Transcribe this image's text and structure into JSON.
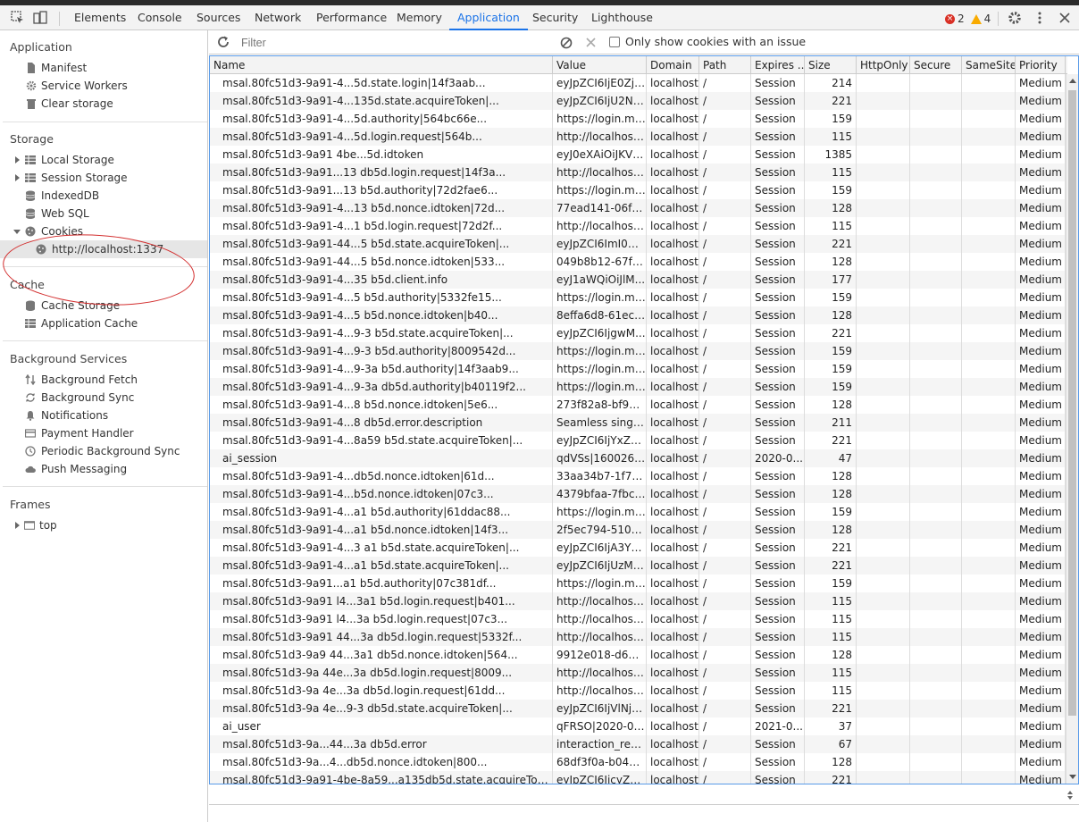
{
  "tabs": [
    "Elements",
    "Console",
    "Sources",
    "Network",
    "Performance",
    "Memory",
    "Application",
    "Security",
    "Lighthouse"
  ],
  "active_tab": "Application",
  "issues": {
    "errors": "2",
    "warnings": "4"
  },
  "sidebar": {
    "application_title": "Application",
    "application_items": [
      "Manifest",
      "Service Workers",
      "Clear storage"
    ],
    "storage_title": "Storage",
    "storage_items": [
      "Local Storage",
      "Session Storage",
      "IndexedDB",
      "Web SQL",
      "Cookies"
    ],
    "cookie_origin": "http://localhost:1337",
    "cache_title": "Cache",
    "cache_items": [
      "Cache Storage",
      "Application Cache"
    ],
    "bg_title": "Background Services",
    "bg_items": [
      "Background Fetch",
      "Background Sync",
      "Notifications",
      "Payment Handler",
      "Periodic Background Sync",
      "Push Messaging"
    ],
    "frames_title": "Frames",
    "frames_items": [
      "top"
    ]
  },
  "toolbar": {
    "filter_placeholder": "Filter",
    "only_issues_label": "Only show cookies with an issue"
  },
  "table": {
    "columns": [
      "Name",
      "Value",
      "Domain",
      "Path",
      "Expires ...",
      "Size",
      "HttpOnly",
      "Secure",
      "SameSite",
      "Priority"
    ],
    "rows": [
      [
        "msal.80fc51d3-9a91-4...5d.state.login|14f3aab...",
        "eyJpZCI6IjE0ZjN...",
        "localhost",
        "/",
        "Session",
        "214",
        "",
        "",
        "",
        "Medium"
      ],
      [
        "msal.80fc51d3-9a91-4...135d.state.acquireToken|...",
        "eyJpZCI6IjU2NG...",
        "localhost",
        "/",
        "Session",
        "221",
        "",
        "",
        "",
        "Medium"
      ],
      [
        "msal.80fc51d3-9a91-4...5d.authority|564bc66e...",
        "https://login.mic...",
        "localhost",
        "/",
        "Session",
        "159",
        "",
        "",
        "",
        "Medium"
      ],
      [
        "msal.80fc51d3-9a91-4...5d.login.request|564b...",
        "http://localhost:...",
        "localhost",
        "/",
        "Session",
        "115",
        "",
        "",
        "",
        "Medium"
      ],
      [
        "msal.80fc51d3-9a91 4be...5d.idtoken",
        "eyJ0eXAiOiJKV1...",
        "localhost",
        "/",
        "Session",
        "1385",
        "",
        "",
        "",
        "Medium"
      ],
      [
        "msal.80fc51d3-9a91...13 db5d.login.request|14f3a...",
        "http://localhost:...",
        "localhost",
        "/",
        "Session",
        "115",
        "",
        "",
        "",
        "Medium"
      ],
      [
        "msal.80fc51d3-9a91...13 b5d.authority|72d2fae6...",
        "https://login.mic...",
        "localhost",
        "/",
        "Session",
        "159",
        "",
        "",
        "",
        "Medium"
      ],
      [
        "msal.80fc51d3-9a91-4...13 b5d.nonce.idtoken|72d...",
        "77ead141-06fb-...",
        "localhost",
        "/",
        "Session",
        "128",
        "",
        "",
        "",
        "Medium"
      ],
      [
        "msal.80fc51d3-9a91-4...1 b5d.login.request|72d2f...",
        "http://localhost:...",
        "localhost",
        "/",
        "Session",
        "115",
        "",
        "",
        "",
        "Medium"
      ],
      [
        "msal.80fc51d3-9a91-44...5 b5d.state.acquireToken|...",
        "eyJpZCI6ImI0M...",
        "localhost",
        "/",
        "Session",
        "221",
        "",
        "",
        "",
        "Medium"
      ],
      [
        "msal.80fc51d3-9a91-44...5 b5d.nonce.idtoken|533...",
        "049b8b12-67f3-...",
        "localhost",
        "/",
        "Session",
        "128",
        "",
        "",
        "",
        "Medium"
      ],
      [
        "msal.80fc51d3-9a91-4...35 b5d.client.info",
        "eyJ1aWQiOiJlM...",
        "localhost",
        "/",
        "Session",
        "177",
        "",
        "",
        "",
        "Medium"
      ],
      [
        "msal.80fc51d3-9a91-4...5 b5d.authority|5332fe15...",
        "https://login.mic...",
        "localhost",
        "/",
        "Session",
        "159",
        "",
        "",
        "",
        "Medium"
      ],
      [
        "msal.80fc51d3-9a91-4...5 b5d.nonce.idtoken|b40...",
        "8effa6d8-61ec-4...",
        "localhost",
        "/",
        "Session",
        "128",
        "",
        "",
        "",
        "Medium"
      ],
      [
        "msal.80fc51d3-9a91-4...9-3 b5d.state.acquireToken|...",
        "eyJpZCI6IjgwM...",
        "localhost",
        "/",
        "Session",
        "221",
        "",
        "",
        "",
        "Medium"
      ],
      [
        "msal.80fc51d3-9a91-4...9-3 b5d.authority|8009542d...",
        "https://login.mic...",
        "localhost",
        "/",
        "Session",
        "159",
        "",
        "",
        "",
        "Medium"
      ],
      [
        "msal.80fc51d3-9a91-4...9-3a b5d.authority|14f3aab9...",
        "https://login.mic...",
        "localhost",
        "/",
        "Session",
        "159",
        "",
        "",
        "",
        "Medium"
      ],
      [
        "msal.80fc51d3-9a91-4...9-3a db5d.authority|b40119f2...",
        "https://login.mic...",
        "localhost",
        "/",
        "Session",
        "159",
        "",
        "",
        "",
        "Medium"
      ],
      [
        "msal.80fc51d3-9a91-4...8 b5d.nonce.idtoken|5e6...",
        "273f82a8-bf9a-...",
        "localhost",
        "/",
        "Session",
        "128",
        "",
        "",
        "",
        "Medium"
      ],
      [
        "msal.80fc51d3-9a91-4...8 db5d.error.description",
        "Seamless single ...",
        "localhost",
        "/",
        "Session",
        "211",
        "",
        "",
        "",
        "Medium"
      ],
      [
        "msal.80fc51d3-9a91-4...8a59 b5d.state.acquireToken|...",
        "eyJpZCI6IjYxZG...",
        "localhost",
        "/",
        "Session",
        "221",
        "",
        "",
        "",
        "Medium"
      ],
      [
        "ai_session",
        "qdVSs|1600267...",
        "localhost",
        "/",
        "2020-0...",
        "47",
        "",
        "",
        "",
        "Medium"
      ],
      [
        "msal.80fc51d3-9a91-4...db5d.nonce.idtoken|61d...",
        "33aa34b7-1f7a-...",
        "localhost",
        "/",
        "Session",
        "128",
        "",
        "",
        "",
        "Medium"
      ],
      [
        "msal.80fc51d3-9a91-4...b5d.nonce.idtoken|07c3...",
        "4379bfaa-7fbc-...",
        "localhost",
        "/",
        "Session",
        "128",
        "",
        "",
        "",
        "Medium"
      ],
      [
        "msal.80fc51d3-9a91-4...a1 b5d.authority|61ddac88...",
        "https://login.mic...",
        "localhost",
        "/",
        "Session",
        "159",
        "",
        "",
        "",
        "Medium"
      ],
      [
        "msal.80fc51d3-9a91-4...a1 b5d.nonce.idtoken|14f3...",
        "2f5ec794-510c-...",
        "localhost",
        "/",
        "Session",
        "128",
        "",
        "",
        "",
        "Medium"
      ],
      [
        "msal.80fc51d3-9a91-4...3 a1 b5d.state.acquireToken|...",
        "eyJpZCI6IjA3Yz...",
        "localhost",
        "/",
        "Session",
        "221",
        "",
        "",
        "",
        "Medium"
      ],
      [
        "msal.80fc51d3-9a91-4...a1 b5d.state.acquireToken|...",
        "eyJpZCI6IjUzMz...",
        "localhost",
        "/",
        "Session",
        "221",
        "",
        "",
        "",
        "Medium"
      ],
      [
        "msal.80fc51d3-9a91...a1 b5d.authority|07c381df...",
        "https://login.mic...",
        "localhost",
        "/",
        "Session",
        "159",
        "",
        "",
        "",
        "Medium"
      ],
      [
        "msal.80fc51d3-9a91 l4...3a1 b5d.login.request|b401...",
        "http://localhost:...",
        "localhost",
        "/",
        "Session",
        "115",
        "",
        "",
        "",
        "Medium"
      ],
      [
        "msal.80fc51d3-9a91 l4...3a b5d.login.request|07c3...",
        "http://localhost:...",
        "localhost",
        "/",
        "Session",
        "115",
        "",
        "",
        "",
        "Medium"
      ],
      [
        "msal.80fc51d3-9a91 44...3a db5d.login.request|5332f...",
        "http://localhost:...",
        "localhost",
        "/",
        "Session",
        "115",
        "",
        "",
        "",
        "Medium"
      ],
      [
        "msal.80fc51d3-9a9 44...3a1 db5d.nonce.idtoken|564...",
        "9912e018-d60d...",
        "localhost",
        "/",
        "Session",
        "128",
        "",
        "",
        "",
        "Medium"
      ],
      [
        "msal.80fc51d3-9a 44e...3a db5d.login.request|8009...",
        "http://localhost:...",
        "localhost",
        "/",
        "Session",
        "115",
        "",
        "",
        "",
        "Medium"
      ],
      [
        "msal.80fc51d3-9a 4e...3a db5d.login.request|61dd...",
        "http://localhost:...",
        "localhost",
        "/",
        "Session",
        "115",
        "",
        "",
        "",
        "Medium"
      ],
      [
        "msal.80fc51d3-9a 4e...9-3 db5d.state.acquireToken|...",
        "eyJpZCI6IjVlNjB...",
        "localhost",
        "/",
        "Session",
        "221",
        "",
        "",
        "",
        "Medium"
      ],
      [
        "ai_user",
        "qFRSO|2020-09-...",
        "localhost",
        "/",
        "2021-0...",
        "37",
        "",
        "",
        "",
        "Medium"
      ],
      [
        "msal.80fc51d3-9a...44...3a db5d.error",
        "interaction_requ...",
        "localhost",
        "/",
        "Session",
        "67",
        "",
        "",
        "",
        "Medium"
      ],
      [
        "msal.80fc51d3-9a...4...db5d.nonce.idtoken|800...",
        "68df3f0a-b048-...",
        "localhost",
        "/",
        "Session",
        "128",
        "",
        "",
        "",
        "Medium"
      ],
      [
        "msal.80fc51d3-9a91-4be-8a59...a135db5d.state.acquireToken|...",
        "eyJpZCI6IjcyZDI...",
        "localhost",
        "/",
        "Session",
        "221",
        "",
        "",
        "",
        "Medium"
      ]
    ]
  }
}
